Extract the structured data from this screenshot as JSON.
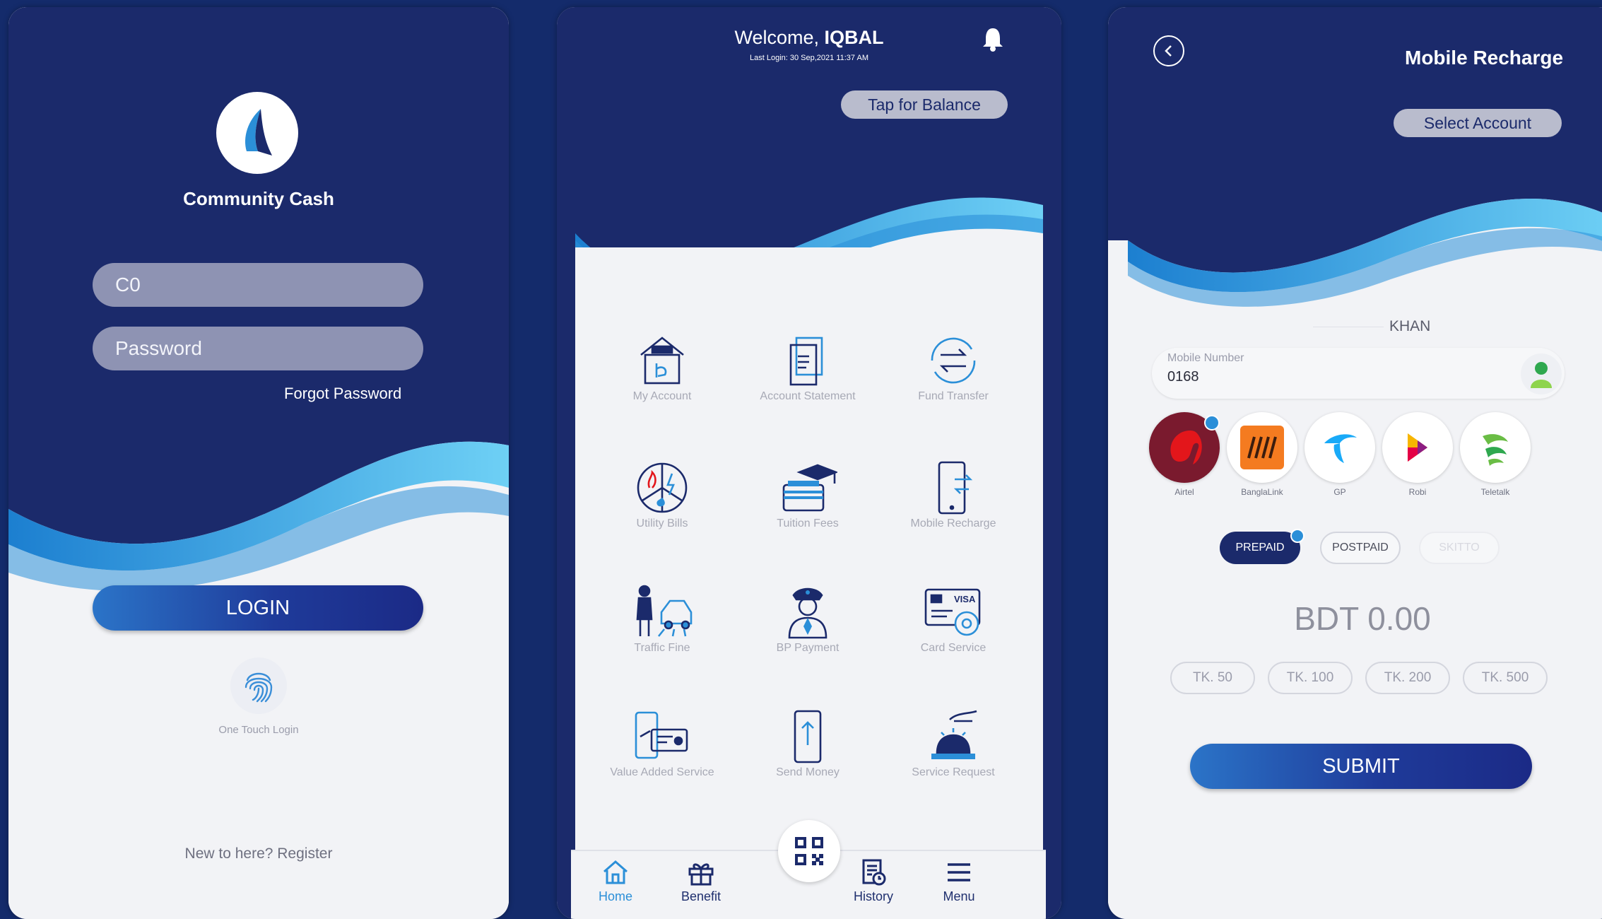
{
  "login_screen": {
    "app_name": "Community Cash",
    "user_field_value": "C0",
    "password_placeholder": "Password",
    "forgot_password": "Forgot Password",
    "login_button": "LOGIN",
    "one_touch_label": "One Touch Login",
    "register_link": "New to here? Register"
  },
  "home_screen": {
    "welcome_prefix": "Welcome,",
    "user_name": "IQBAL",
    "last_login": "Last Login: 30 Sep,2021 11:37 AM",
    "balance_button": "Tap for Balance",
    "services": [
      {
        "label": "My Account",
        "icon": "bank-icon"
      },
      {
        "label": "Account Statement",
        "icon": "statement-icon"
      },
      {
        "label": "Fund Transfer",
        "icon": "transfer-icon"
      },
      {
        "label": "Utility Bills",
        "icon": "utility-icon"
      },
      {
        "label": "Tuition Fees",
        "icon": "tuition-icon"
      },
      {
        "label": "Mobile Recharge",
        "icon": "mobile-recharge-icon"
      },
      {
        "label": "Traffic Fine",
        "icon": "traffic-icon"
      },
      {
        "label": "BP Payment",
        "icon": "police-icon"
      },
      {
        "label": "Card Service",
        "icon": "card-icon"
      },
      {
        "label": "Value Added Service",
        "icon": "value-added-icon"
      },
      {
        "label": "Send Money",
        "icon": "send-money-icon"
      },
      {
        "label": "Service Request",
        "icon": "service-request-icon"
      }
    ],
    "nav": [
      {
        "label": "Home",
        "icon": "home-icon"
      },
      {
        "label": "Benefit",
        "icon": "gift-icon"
      },
      {
        "label": "History",
        "icon": "history-icon"
      },
      {
        "label": "Menu",
        "icon": "menu-icon"
      }
    ]
  },
  "recharge_screen": {
    "title": "Mobile Recharge",
    "select_account": "Select Account",
    "account_holder": "KHAN",
    "mobile_label": "Mobile Number",
    "mobile_value": "0168",
    "operators": [
      "Airtel",
      "BanglaLink",
      "GP",
      "Robi",
      "Teletalk"
    ],
    "plan_types": [
      "PREPAID",
      "POSTPAID",
      "SKITTO"
    ],
    "amount_display": "BDT 0.00",
    "amounts": [
      "TK. 50",
      "TK. 100",
      "TK. 200",
      "TK. 500"
    ],
    "submit_button": "SUBMIT"
  },
  "colors": {
    "navy": "#1b2a6b",
    "accent_blue": "#2b8fd8",
    "light_blue": "#5fc7f0",
    "airtel_red": "#e3161b"
  }
}
